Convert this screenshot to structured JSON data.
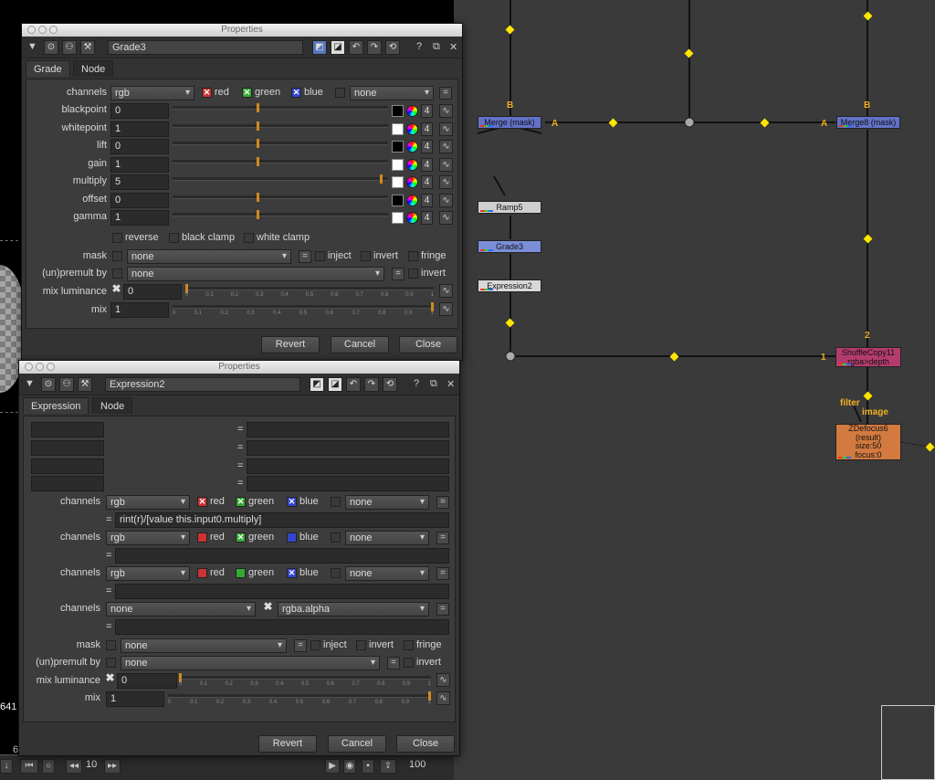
{
  "viewer": {
    "coord": "641",
    "frame_start": "10",
    "frame_end": "100",
    "frame_left": "6"
  },
  "graph": {
    "nodes": {
      "merge_disabled": "Merge (mask)",
      "merge8": "Merge8 (mask)",
      "ramp5": "Ramp5",
      "grade3": "Grade3",
      "expression2": "Expression2",
      "shuffle_line1": "ShuffleCopy11",
      "shuffle_line2": "rgba>depth",
      "zdefocus_line1": "ZDefocus6",
      "zdefocus_line2": "(result)",
      "zdefocus_line3": "size:50",
      "zdefocus_line4": "focus:0"
    },
    "inputs": {
      "b1": "B",
      "a1": "A",
      "b2": "B",
      "a2": "A",
      "two": "2",
      "one": "1",
      "filter": "filter",
      "image": "image"
    }
  },
  "grade_panel": {
    "window_title": "Properties",
    "node_name": "Grade3",
    "tabs": [
      "Grade",
      "Node"
    ],
    "channels_label": "channels",
    "channels_value": "rgb",
    "red": "red",
    "green": "green",
    "blue": "blue",
    "extra_channel": "none",
    "equals": "=",
    "rows": [
      {
        "label": "blackpoint",
        "value": "0"
      },
      {
        "label": "whitepoint",
        "value": "1"
      },
      {
        "label": "lift",
        "value": "0"
      },
      {
        "label": "gain",
        "value": "1"
      },
      {
        "label": "multiply",
        "value": "5"
      },
      {
        "label": "offset",
        "value": "0"
      },
      {
        "label": "gamma",
        "value": "1"
      }
    ],
    "four": "4",
    "reverse": "reverse",
    "black_clamp": "black clamp",
    "white_clamp": "white clamp",
    "mask_label": "mask",
    "mask_value": "none",
    "inject": "inject",
    "invert": "invert",
    "fringe": "fringe",
    "premult_label": "(un)premult by",
    "premult_value": "none",
    "premult_invert": "invert",
    "mixlum_label": "mix luminance",
    "mixlum_value": "0",
    "mix_label": "mix",
    "mix_value": "1",
    "revert": "Revert",
    "cancel": "Cancel",
    "close": "Close"
  },
  "expr_panel": {
    "window_title": "Properties",
    "node_name": "Expression2",
    "tabs": [
      "Expression",
      "Node"
    ],
    "channels_label": "channels",
    "equals": "=",
    "ch1": {
      "value": "rgb",
      "red": "red",
      "green": "green",
      "blue": "blue",
      "extra": "none",
      "expr": "rint(r)/[value this.input0.multiply]"
    },
    "ch2": {
      "value": "rgb",
      "red": "red",
      "green": "green",
      "blue": "blue",
      "extra": "none",
      "expr": ""
    },
    "ch3": {
      "value": "rgb",
      "red": "red",
      "green": "green",
      "blue": "blue",
      "extra": "none",
      "expr": ""
    },
    "ch4": {
      "value": "none",
      "extra": "rgba.alpha",
      "expr": ""
    },
    "mask_label": "mask",
    "mask_value": "none",
    "inject": "inject",
    "invert": "invert",
    "fringe": "fringe",
    "premult_label": "(un)premult by",
    "premult_value": "none",
    "premult_invert": "invert",
    "mixlum_label": "mix luminance",
    "mixlum_value": "0",
    "mix_label": "mix",
    "mix_value": "1",
    "revert": "Revert",
    "cancel": "Cancel",
    "close": "Close"
  }
}
